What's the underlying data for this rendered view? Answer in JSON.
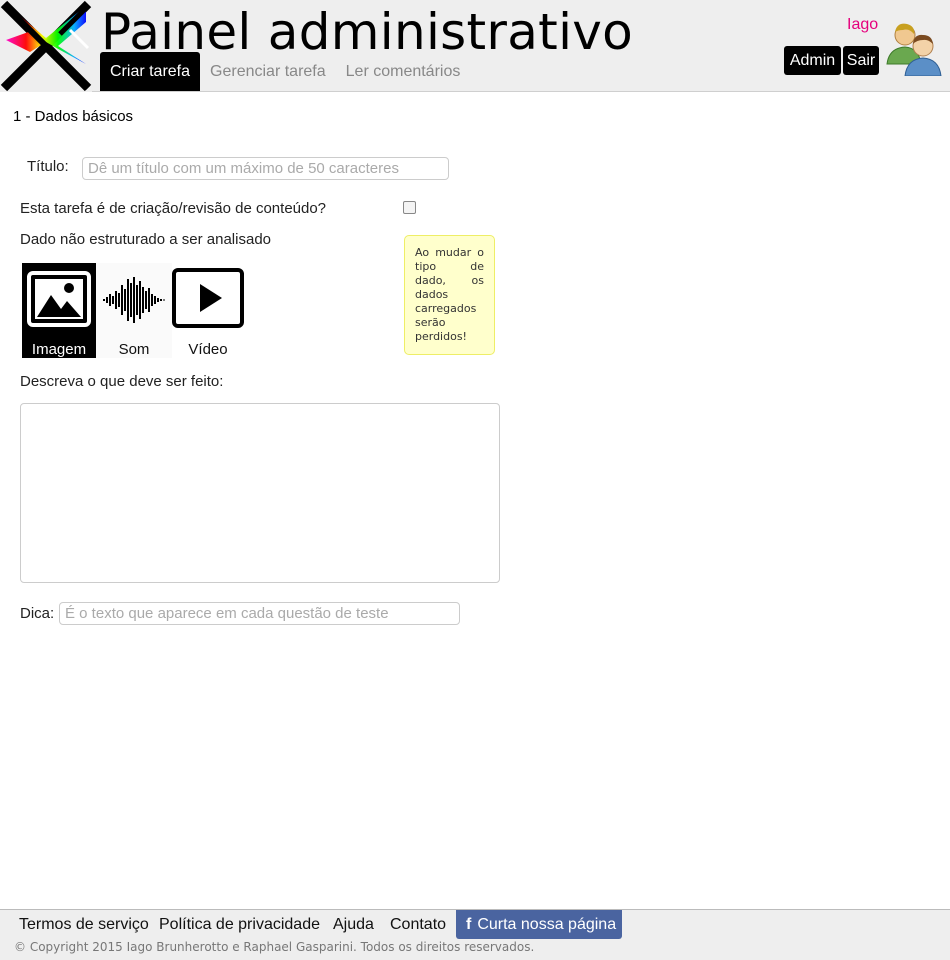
{
  "header": {
    "title": "Painel administrativo",
    "tabs": [
      {
        "label": "Criar tarefa",
        "active": true
      },
      {
        "label": "Gerenciar tarefa",
        "active": false
      },
      {
        "label": "Ler comentários",
        "active": false
      }
    ],
    "user_name": "Iago",
    "admin_label": "Admin",
    "logout_label": "Sair",
    "logo_icon": "cross-color-logo",
    "avatar_icon": "users-avatar-icon"
  },
  "form": {
    "section_title": "1 - Dados básicos",
    "title_label": "Título:",
    "title_placeholder": "Dê um título com um máximo de 50 caracteres",
    "content_review_label": "Esta tarefa é de criação/revisão de conteúdo?",
    "content_review_checked": false,
    "data_type_label": "Dado não estruturado a ser analisado",
    "data_types": [
      {
        "label": "Imagem",
        "icon": "image-icon",
        "selected": true
      },
      {
        "label": "Som",
        "icon": "sound-wave-icon",
        "selected": false
      },
      {
        "label": "Vídeo",
        "icon": "video-play-icon",
        "selected": false
      }
    ],
    "warning_note": "Ao mudar o tipo de dado, os dados carregados serão perdidos!",
    "description_label": "Descreva o que deve ser feito:",
    "description_value": "",
    "hint_label": "Dica:",
    "hint_placeholder": "É o texto que aparece em cada questão de teste"
  },
  "footer": {
    "links": [
      "Termos de serviço",
      "Política de privacidade",
      "Ajuda",
      "Contato"
    ],
    "facebook_label": "Curta nossa página",
    "facebook_icon": "facebook-icon",
    "copyright": "© Copyright 2015 Iago Brunherotto e Raphael Gasparini. Todos os direitos reservados."
  },
  "colors": {
    "header_bg": "#eeeeee",
    "active_tab": "#000000",
    "user_name": "#e5007d",
    "note_bg": "#ffffcc",
    "facebook": "#4a64a0"
  }
}
